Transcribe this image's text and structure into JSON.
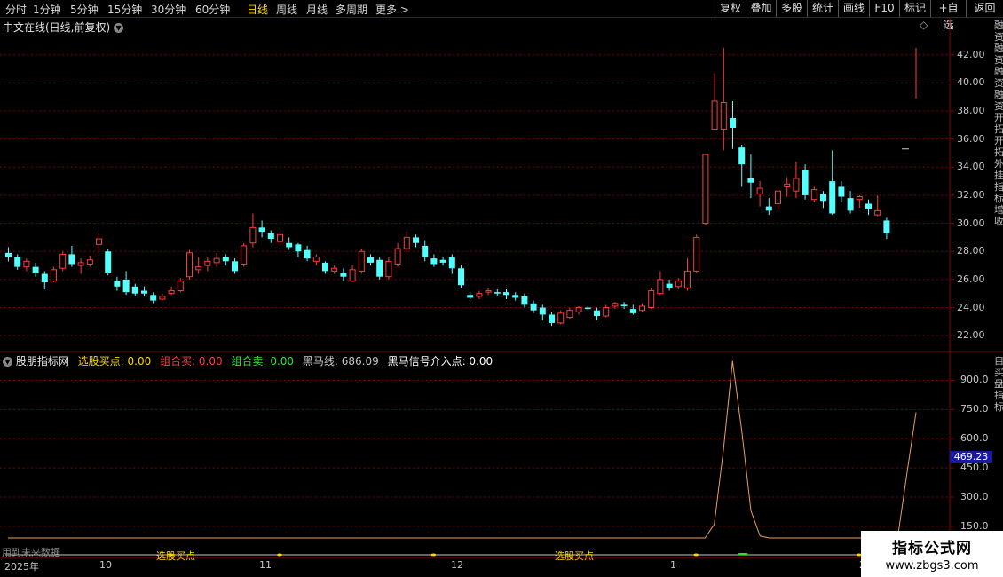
{
  "toolbar": {
    "period_tabs": [
      "分时",
      "1分钟",
      "5分钟",
      "15分钟",
      "30分钟",
      "60分钟",
      "日线",
      "周线",
      "月线",
      "多周期",
      "更多"
    ],
    "active_tab": "日线",
    "more_arrow": ">",
    "buttons": [
      "复权",
      "叠加",
      "多股",
      "统计",
      "画线",
      "F10",
      "标记",
      "+自选",
      "返回"
    ]
  },
  "main_chart": {
    "title": "中文在线(日线,前复权)",
    "dropdown_icon": "chevron-down-icon",
    "diamond_icon": "◇",
    "side_text": "融资融资融资融资开拓开拓外挂指标增收",
    "colors": {
      "up": "#ff3c3c",
      "down": "#54ffff",
      "grid": "#7a0000"
    }
  },
  "indicator": {
    "name": "股朋指标网",
    "labels": [
      {
        "text": "选股买点: 0.00",
        "color": "#ffd700"
      },
      {
        "text": "组合买: 0.00",
        "color": "#ff3c3c"
      },
      {
        "text": "组合卖: 0.00",
        "color": "#2ee52e"
      },
      {
        "text": "黑马线: 686.09",
        "color": "#c8c8c8"
      },
      {
        "text": "黑马信号介入点: 0.00",
        "color": "#ffffff"
      }
    ],
    "current_value": "469.23",
    "side_text": "自买盘指标",
    "future_note": "用到未来数据",
    "signal_labels": [
      "选股买点",
      "选股买点"
    ]
  },
  "chart_data": [
    {
      "type": "candlestick",
      "title": "中文在线(日线,前复权)",
      "ylim": [
        21,
        43.5
      ],
      "y_ticks": [
        "42.00",
        "40.00",
        "38.00",
        "36.00",
        "34.00",
        "32.00",
        "30.00",
        "28.00",
        "26.00",
        "24.00",
        "22.00"
      ],
      "candles": [
        [
          27.9,
          27.6,
          28.3,
          27.3
        ],
        [
          27.6,
          26.9,
          27.8,
          26.7
        ],
        [
          26.9,
          27.3,
          27.5,
          26.6
        ],
        [
          26.9,
          26.5,
          27.2,
          26.2
        ],
        [
          26.4,
          25.8,
          26.6,
          25.3
        ],
        [
          25.9,
          26.7,
          26.9,
          25.8
        ],
        [
          26.8,
          27.8,
          28.0,
          26.6
        ],
        [
          27.8,
          27.1,
          28.4,
          26.9
        ],
        [
          27.0,
          27.2,
          27.5,
          26.4
        ],
        [
          27.1,
          27.4,
          27.7,
          26.9
        ],
        [
          28.5,
          28.9,
          29.3,
          27.9
        ],
        [
          28.0,
          26.5,
          28.2,
          26.3
        ],
        [
          25.9,
          25.5,
          26.2,
          25.2
        ],
        [
          26.0,
          25.1,
          26.6,
          24.9
        ],
        [
          25.5,
          25.0,
          25.7,
          24.8
        ],
        [
          25.2,
          25.0,
          25.5,
          24.8
        ],
        [
          24.9,
          24.5,
          25.1,
          24.3
        ],
        [
          24.6,
          24.8,
          25.0,
          24.5
        ],
        [
          25.0,
          25.2,
          25.5,
          24.9
        ],
        [
          25.2,
          25.9,
          26.1,
          25.1
        ],
        [
          26.2,
          27.9,
          28.1,
          26.0
        ],
        [
          26.7,
          26.9,
          27.6,
          26.4
        ],
        [
          27.0,
          27.3,
          27.6,
          26.6
        ],
        [
          27.2,
          27.5,
          27.9,
          26.9
        ],
        [
          27.6,
          27.3,
          27.8,
          27.0
        ],
        [
          27.3,
          26.6,
          27.5,
          26.4
        ],
        [
          27.1,
          28.4,
          28.6,
          26.9
        ],
        [
          28.6,
          29.7,
          30.7,
          28.3
        ],
        [
          29.7,
          29.4,
          30.2,
          29.0
        ],
        [
          29.3,
          28.9,
          29.5,
          28.6
        ],
        [
          28.7,
          29.2,
          29.4,
          28.5
        ],
        [
          28.6,
          28.3,
          29.0,
          28.1
        ],
        [
          28.5,
          28.0,
          28.6,
          27.6
        ],
        [
          28.1,
          27.5,
          28.4,
          27.3
        ],
        [
          27.3,
          27.6,
          27.8,
          27.0
        ],
        [
          27.2,
          26.6,
          27.3,
          26.4
        ],
        [
          26.6,
          26.8,
          27.0,
          26.4
        ],
        [
          26.5,
          26.2,
          26.8,
          25.9
        ],
        [
          25.9,
          26.7,
          27.0,
          25.8
        ],
        [
          26.6,
          28.0,
          28.2,
          26.4
        ],
        [
          27.6,
          27.2,
          27.8,
          27.0
        ],
        [
          27.4,
          26.2,
          27.6,
          26.0
        ],
        [
          26.2,
          27.3,
          27.6,
          26.0
        ],
        [
          27.1,
          28.2,
          28.6,
          26.9
        ],
        [
          28.2,
          29.0,
          29.4,
          27.9
        ],
        [
          29.0,
          28.6,
          29.2,
          28.3
        ],
        [
          28.4,
          27.6,
          28.8,
          27.3
        ],
        [
          27.5,
          27.1,
          27.8,
          26.9
        ],
        [
          27.4,
          27.2,
          27.6,
          27.0
        ],
        [
          27.6,
          26.8,
          27.8,
          26.4
        ],
        [
          26.8,
          25.6,
          27.0,
          25.4
        ],
        [
          24.9,
          24.7,
          25.1,
          24.6
        ],
        [
          24.8,
          25.0,
          25.2,
          24.6
        ],
        [
          25.1,
          25.2,
          25.4,
          24.9
        ],
        [
          25.1,
          25.0,
          25.3,
          24.8
        ],
        [
          25.1,
          24.9,
          25.3,
          24.6
        ],
        [
          24.9,
          24.7,
          25.1,
          24.5
        ],
        [
          24.8,
          24.2,
          25.0,
          24.0
        ],
        [
          24.3,
          23.8,
          24.5,
          23.6
        ],
        [
          24.0,
          23.5,
          24.2,
          23.1
        ],
        [
          23.5,
          22.9,
          23.7,
          22.7
        ],
        [
          22.9,
          23.6,
          23.8,
          22.8
        ],
        [
          23.3,
          23.8,
          24.0,
          23.2
        ],
        [
          23.7,
          24.0,
          24.1,
          23.5
        ],
        [
          24.0,
          23.9,
          24.1,
          23.8
        ],
        [
          23.8,
          23.4,
          24.0,
          23.1
        ],
        [
          23.4,
          24.0,
          24.2,
          23.3
        ],
        [
          24.1,
          24.3,
          24.4,
          23.9
        ],
        [
          24.2,
          24.1,
          24.4,
          23.9
        ],
        [
          23.9,
          23.6,
          24.2,
          23.5
        ],
        [
          23.8,
          24.1,
          24.3,
          23.7
        ],
        [
          24.0,
          25.2,
          25.4,
          23.9
        ],
        [
          25.0,
          26.0,
          26.6,
          24.9
        ],
        [
          25.7,
          25.4,
          26.0,
          25.2
        ],
        [
          25.5,
          25.9,
          26.1,
          25.3
        ],
        [
          25.4,
          26.6,
          27.5,
          25.2
        ],
        [
          26.6,
          29.0,
          29.2,
          26.5
        ],
        [
          30.0,
          34.9,
          34.9,
          29.9
        ],
        [
          36.7,
          38.7,
          40.7,
          36.7
        ],
        [
          36.7,
          38.6,
          42.5,
          35.2
        ],
        [
          37.5,
          36.8,
          38.7,
          35.3
        ],
        [
          35.4,
          34.2,
          35.6,
          32.6
        ],
        [
          33.2,
          32.9,
          34.9,
          31.8
        ],
        [
          32.1,
          32.5,
          33.0,
          31.2
        ],
        [
          31.2,
          30.9,
          31.8,
          30.6
        ],
        [
          31.4,
          32.3,
          32.4,
          31.0
        ],
        [
          32.6,
          32.8,
          33.3,
          31.9
        ],
        [
          32.3,
          33.2,
          34.4,
          31.8
        ],
        [
          33.8,
          32.0,
          34.2,
          31.7
        ],
        [
          31.7,
          32.4,
          32.6,
          31.5
        ],
        [
          32.1,
          31.6,
          32.3,
          31.1
        ],
        [
          33.0,
          30.7,
          35.2,
          30.6
        ],
        [
          32.6,
          31.9,
          33.0,
          31.5
        ],
        [
          31.8,
          30.9,
          32.3,
          30.7
        ],
        [
          31.7,
          31.9,
          32.0,
          31.1
        ],
        [
          31.4,
          31.0,
          31.7,
          30.6
        ],
        [
          30.6,
          30.9,
          32.0,
          30.5
        ],
        [
          30.2,
          29.3,
          30.4,
          28.9
        ]
      ],
      "today_tick": {
        "open": 39.0,
        "close": 42.3,
        "high": 42.5,
        "low": 38.9
      },
      "mark_price": 35.3
    },
    {
      "type": "line",
      "series": [
        {
          "values": [
            2,
            2,
            2,
            2,
            2,
            2,
            2,
            2,
            2,
            2,
            2,
            2,
            2,
            2,
            2,
            2,
            2,
            2,
            2,
            2,
            2,
            2,
            2,
            2,
            2,
            2,
            2,
            2,
            2,
            2,
            2,
            2,
            2,
            2,
            2,
            2,
            2,
            2,
            2,
            2,
            2,
            2,
            2,
            2,
            2,
            2,
            2,
            2,
            2,
            2,
            2,
            2,
            2,
            2,
            2,
            2,
            2,
            2,
            2,
            2,
            2,
            2,
            2,
            2,
            2,
            2,
            2,
            2,
            2,
            2,
            2,
            2,
            2,
            2,
            2,
            2,
            10,
            160,
            540,
            1000,
            640,
            230,
            100,
            60,
            45,
            55,
            90,
            65,
            50,
            60,
            40,
            30,
            25,
            15,
            35,
            25,
            20,
            10,
            420,
            735
          ]
        }
      ],
      "ylim": [
        90,
        1030
      ],
      "y_ticks": [
        "900.0",
        "750.0",
        "600.0",
        "450.0",
        "300.0",
        "150.0"
      ]
    }
  ],
  "date_axis": {
    "labels": [
      "2025年",
      "10",
      "11",
      "12",
      "1",
      "2"
    ]
  }
}
